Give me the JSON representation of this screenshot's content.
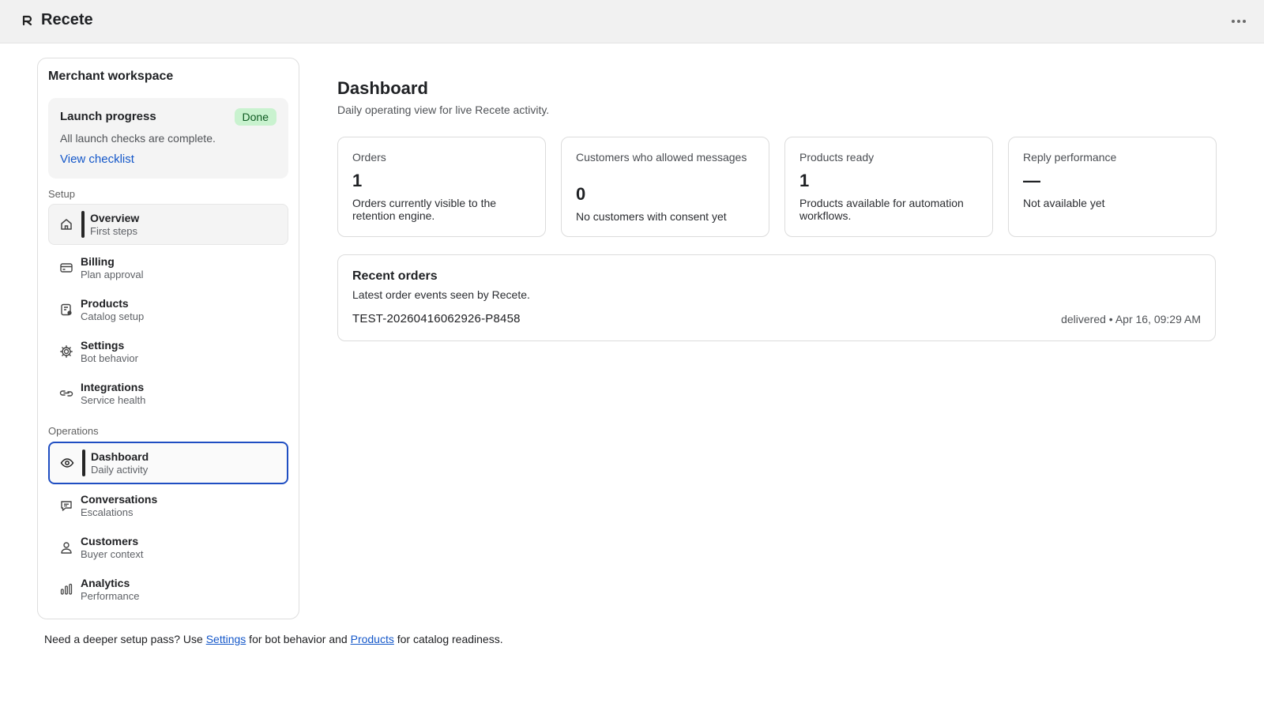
{
  "app": {
    "title": "Recete"
  },
  "sidebar": {
    "title": "Merchant workspace",
    "launch": {
      "title": "Launch progress",
      "badge": "Done",
      "description": "All launch checks are complete.",
      "link": "View checklist"
    },
    "sections": {
      "setup": "Setup",
      "operations": "Operations"
    },
    "setup_items": [
      {
        "label": "Overview",
        "sub": "First steps",
        "icon": "home-icon"
      },
      {
        "label": "Billing",
        "sub": "Plan approval",
        "icon": "credit-card-icon"
      },
      {
        "label": "Products",
        "sub": "Catalog setup",
        "icon": "products-icon"
      },
      {
        "label": "Settings",
        "sub": "Bot behavior",
        "icon": "gear-icon"
      },
      {
        "label": "Integrations",
        "sub": "Service health",
        "icon": "link-icon"
      }
    ],
    "operations_items": [
      {
        "label": "Dashboard",
        "sub": "Daily activity",
        "icon": "eye-icon",
        "active": true
      },
      {
        "label": "Conversations",
        "sub": "Escalations",
        "icon": "chat-icon"
      },
      {
        "label": "Customers",
        "sub": "Buyer context",
        "icon": "user-icon"
      },
      {
        "label": "Analytics",
        "sub": "Performance",
        "icon": "bar-chart-icon"
      }
    ]
  },
  "footer": {
    "prefix": "Need a deeper setup pass? Use ",
    "settings_link": "Settings",
    "middle": " for bot behavior and ",
    "products_link": "Products",
    "suffix": " for catalog readiness."
  },
  "main": {
    "title": "Dashboard",
    "subtitle": "Daily operating view for live Recete activity.",
    "cards": [
      {
        "label": "Orders",
        "value": "1",
        "description": "Orders currently visible to the retention engine."
      },
      {
        "label": "Customers who allowed messages",
        "value": "0",
        "description": "No customers with consent yet"
      },
      {
        "label": "Products ready",
        "value": "1",
        "description": "Products available for automation workflows."
      },
      {
        "label": "Reply performance",
        "value": "—",
        "description": "Not available yet"
      }
    ],
    "recent_orders": {
      "title": "Recent orders",
      "subtitle": "Latest order events seen by Recete.",
      "rows": [
        {
          "id": "TEST-20260416062926-P8458",
          "meta": "delivered • Apr 16, 09:29 AM"
        }
      ]
    }
  },
  "colors": {
    "accent": "#1f4ec2",
    "link": "#1457c9",
    "badge_bg": "#c9f2cf",
    "badge_text": "#0f5b22"
  }
}
